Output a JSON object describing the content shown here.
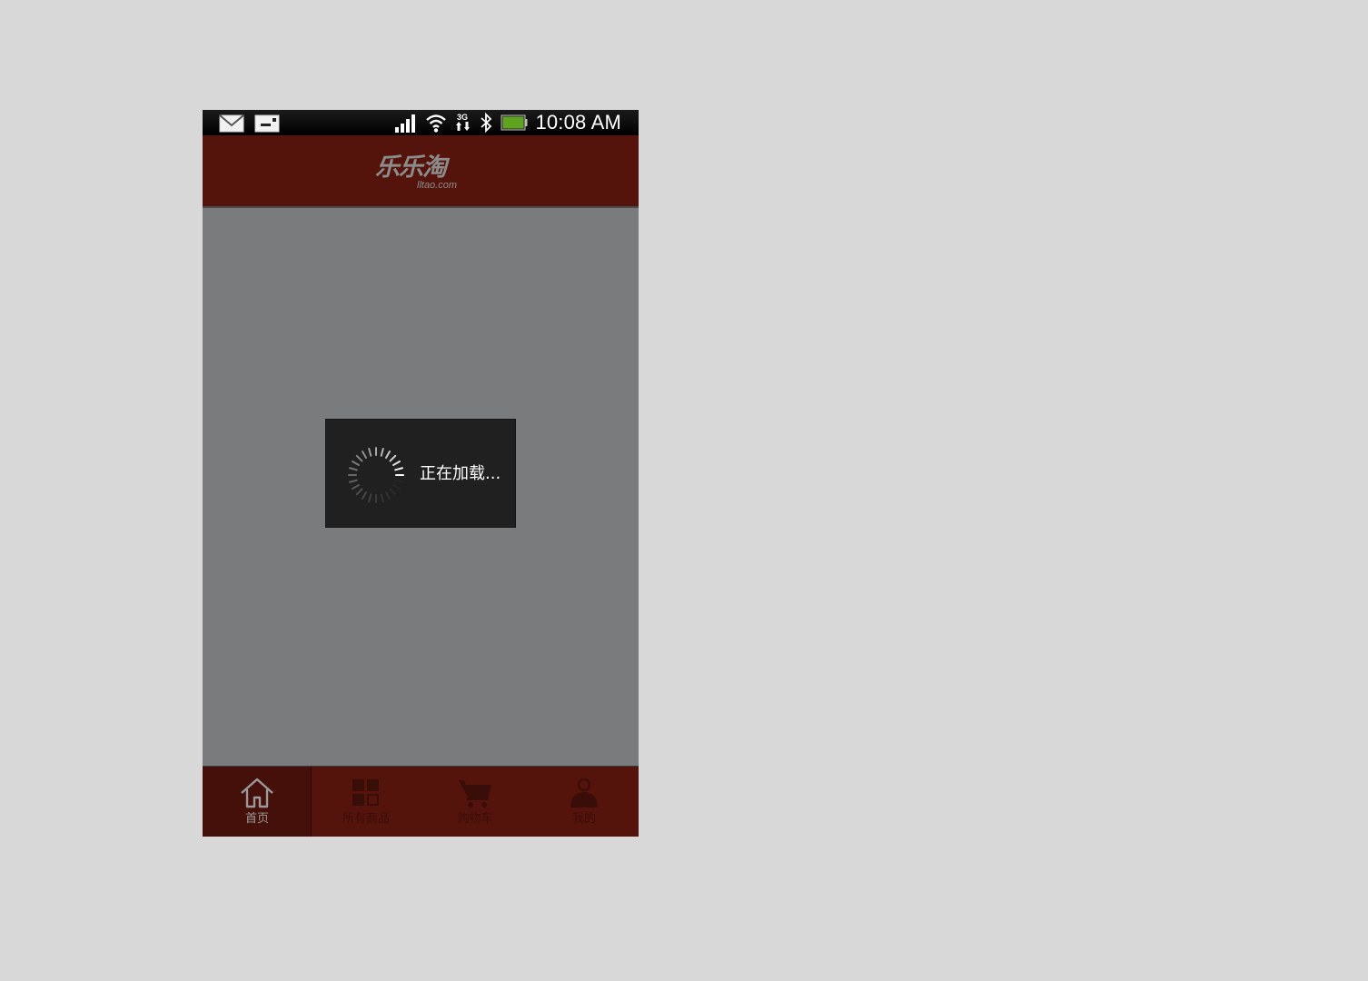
{
  "status_bar": {
    "time": "10:08 AM",
    "icons": [
      "mail-icon",
      "sim-card-icon",
      "signal-icon",
      "wifi-icon",
      "3g-data-icon",
      "bluetooth-icon",
      "battery-icon"
    ],
    "network_label": "3G",
    "battery_color": "#5fa31f"
  },
  "header": {
    "logo_main": "乐乐淘",
    "logo_sub": "lltao.com",
    "background": "#54140b"
  },
  "loading": {
    "text": "正在加载..."
  },
  "bottom_nav": {
    "items": [
      {
        "label": "首页",
        "icon": "home-icon",
        "active": true
      },
      {
        "label": "所有商品",
        "icon": "grid-icon",
        "active": false
      },
      {
        "label": "购物车",
        "icon": "cart-icon",
        "active": false
      },
      {
        "label": "我的",
        "icon": "user-icon",
        "active": false
      }
    ]
  }
}
